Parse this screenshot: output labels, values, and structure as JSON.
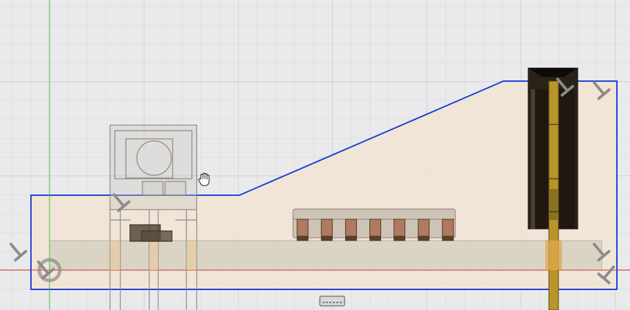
{
  "viewport": {
    "background": "#eaeaec",
    "grid_minor": "#d8d8da",
    "grid_major": "#c6c6c8",
    "x_axis_color": "#c0392b",
    "y_axis_color": "#3cc43c",
    "sketch_profile_color": "#1a3fd6",
    "profile_fill": "#f2e3d2",
    "board_fill": "#c9c6b4",
    "component_dark": "#2a2218",
    "pin_gold": "#b8952a"
  },
  "icons": {
    "cursor": "hand-pan-icon",
    "constraint": "fix-constraint-icon",
    "origin": "origin-icon",
    "bottom": "connector-icon"
  }
}
